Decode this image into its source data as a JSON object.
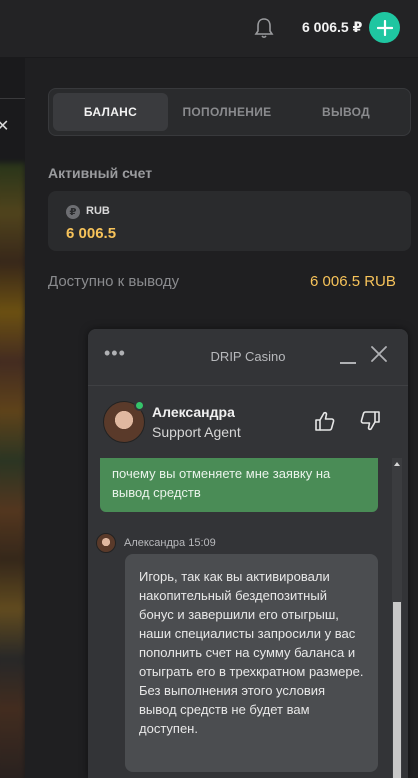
{
  "topbar": {
    "balance": "6 006.5 ₽",
    "icons": {
      "notifications": "bell-icon",
      "deposit": "plus-icon"
    }
  },
  "tabs": [
    {
      "label": "БАЛАНС",
      "active": true
    },
    {
      "label": "ПОПОЛНЕНИЕ",
      "active": false
    },
    {
      "label": "ВЫВОД",
      "active": false
    }
  ],
  "account": {
    "section_title": "Активный счет",
    "currency_symbol": "₽",
    "currency": "RUB",
    "amount": "6 006.5"
  },
  "withdrawable": {
    "label": "Доступно к выводу",
    "value": "6 006.5 RUB"
  },
  "chat": {
    "title": "DRIP Casino",
    "agent": {
      "name": "Александра",
      "role": "Support Agent",
      "online": true
    },
    "messages": [
      {
        "from": "user",
        "text": "почему вы отменяете мне заявку на вывод средств"
      },
      {
        "from": "agent",
        "meta": "Александра 15:09",
        "text": "Игорь, так как вы активировали накопительный бездепозитный бонус и завершили его отыгрыш, наши специалисты запросили у вас пополнить счет на сумму баланса и отыграть его в трехкратном размере. Без выполнения этого условия вывод средств не будет вам доступен."
      }
    ]
  },
  "colors": {
    "accent": "#1fc6a1",
    "amount": "#f7c35a",
    "user_bubble": "#4a8c56",
    "agent_bubble": "#4b4d50"
  }
}
